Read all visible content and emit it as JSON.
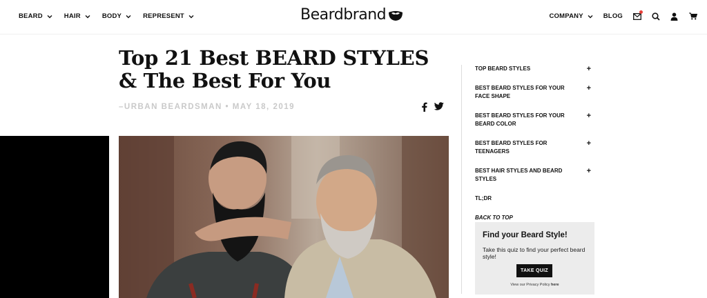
{
  "header": {
    "nav_left": [
      {
        "label": "BEARD"
      },
      {
        "label": "HAIR"
      },
      {
        "label": "BODY"
      },
      {
        "label": "REPRESENT"
      }
    ],
    "logo_text": "Beardbrand",
    "nav_right": {
      "company": "COMPANY",
      "blog": "BLOG"
    },
    "icons": [
      "mail-icon",
      "search-icon",
      "user-icon",
      "cart-icon"
    ],
    "accent_color": "#e8413b"
  },
  "article": {
    "title": "Top 21 Best BEARD STYLES & The Best For You",
    "byline": "–URBAN BEARDSMAN • MAY 18, 2019",
    "share_icons": [
      "facebook-icon",
      "twitter-icon"
    ]
  },
  "toc": {
    "items": [
      {
        "label": "TOP BEARD STYLES",
        "plus": "+"
      },
      {
        "label": "BEST BEARD STYLES FOR YOUR FACE SHAPE",
        "plus": "+"
      },
      {
        "label": "BEST BEARD STYLES FOR YOUR BEARD COLOR",
        "plus": "+"
      },
      {
        "label": "BEST BEARD STYLES FOR TEENAGERS",
        "plus": "+"
      },
      {
        "label": "BEST HAIR STYLES AND BEARD STYLES",
        "plus": "+"
      },
      {
        "label": "TL;DR"
      },
      {
        "label": "BACK TO TOP"
      }
    ]
  },
  "quiz": {
    "title": "Find your Beard Style!",
    "text": "Take this quiz to find your perfect beard style!",
    "button": "TAKE QUIZ",
    "privacy_prefix": "View our Privacy Policy",
    "privacy_link": "here"
  }
}
